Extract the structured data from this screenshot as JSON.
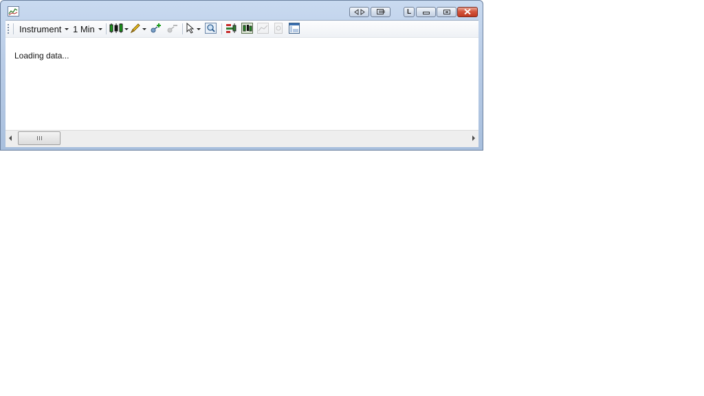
{
  "window": {
    "icon": "chart-icon",
    "title_buttons": {
      "link_label": "L",
      "sync_icon": "left-right-arrows-icon",
      "popout_icon": "window-link-icon",
      "minimize_icon": "minimize-icon",
      "maximize_icon": "maximize-icon",
      "close_icon": "close-icon"
    }
  },
  "toolbar": {
    "instrument_label": "Instrument",
    "interval_label": "1 Min",
    "tools": [
      {
        "name": "chart-style",
        "icon": "candlestick-icon",
        "has_dropdown": true,
        "enabled": true
      },
      {
        "name": "drawing-tool",
        "icon": "pencil-icon",
        "has_dropdown": true,
        "enabled": true
      },
      {
        "name": "add-indicator",
        "icon": "add-indicator-icon",
        "has_dropdown": false,
        "enabled": true
      },
      {
        "name": "remove-indicator",
        "icon": "remove-indicator-icon",
        "has_dropdown": false,
        "enabled": false
      },
      {
        "name": "cursor-mode",
        "icon": "cursor-icon",
        "has_dropdown": true,
        "enabled": true
      },
      {
        "name": "zoom",
        "icon": "magnifier-icon",
        "has_dropdown": false,
        "enabled": true
      },
      {
        "name": "strategies",
        "icon": "strategy-bars-icon",
        "has_dropdown": false,
        "enabled": true
      },
      {
        "name": "indicators",
        "icon": "indicator-chart-icon",
        "has_dropdown": false,
        "enabled": true
      },
      {
        "name": "properties",
        "icon": "chart-properties-icon",
        "has_dropdown": false,
        "enabled": false
      },
      {
        "name": "data-box",
        "icon": "data-box-icon",
        "has_dropdown": false,
        "enabled": false
      },
      {
        "name": "panel-layout",
        "icon": "panel-layout-icon",
        "has_dropdown": false,
        "enabled": true
      }
    ]
  },
  "content": {
    "status_text": "Loading data..."
  },
  "scrollbar": {
    "left_icon": "scroll-left-icon",
    "right_icon": "scroll-right-icon"
  },
  "colors": {
    "frame": "#b9cce6",
    "close_button": "#c9432b"
  }
}
